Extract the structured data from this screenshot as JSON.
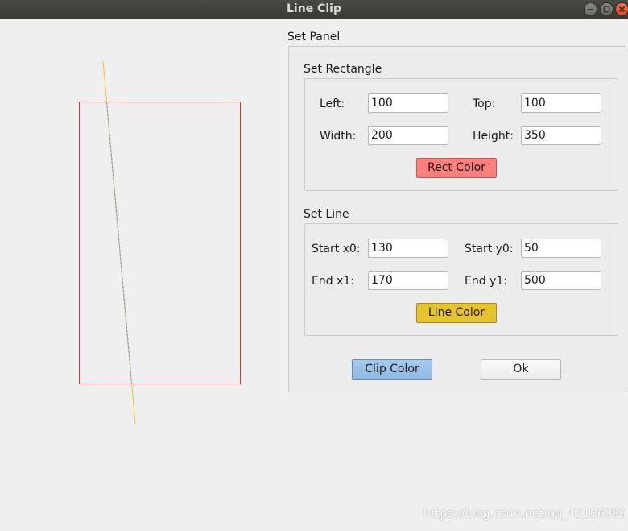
{
  "window": {
    "title": "Line Clip"
  },
  "panel": {
    "title": "Set Panel",
    "rectangle": {
      "title": "Set Rectangle",
      "left_label": "Left:",
      "left_value": "100",
      "top_label": "Top:",
      "top_value": "100",
      "width_label": "Width:",
      "width_value": "200",
      "height_label": "Height:",
      "height_value": "350",
      "color_button": "Rect Color"
    },
    "line": {
      "title": "Set Line",
      "x0_label": "Start x0:",
      "x0_value": "130",
      "y0_label": "Start y0:",
      "y0_value": "50",
      "x1_label": "End x1:",
      "x1_value": "170",
      "y1_label": "End y1:",
      "y1_value": "500",
      "color_button": "Line Color"
    },
    "clip_color_button": "Clip Color",
    "ok_button": "Ok"
  },
  "colors": {
    "rect": "#e03030",
    "line": "#e6c22c",
    "clip": "#6f9fd8",
    "rect_button": "#ff7f7f",
    "line_button": "#e6c22c",
    "clip_button": "#8fb8e2"
  },
  "watermark": "https://blog.csdn.net/qq_42186999"
}
